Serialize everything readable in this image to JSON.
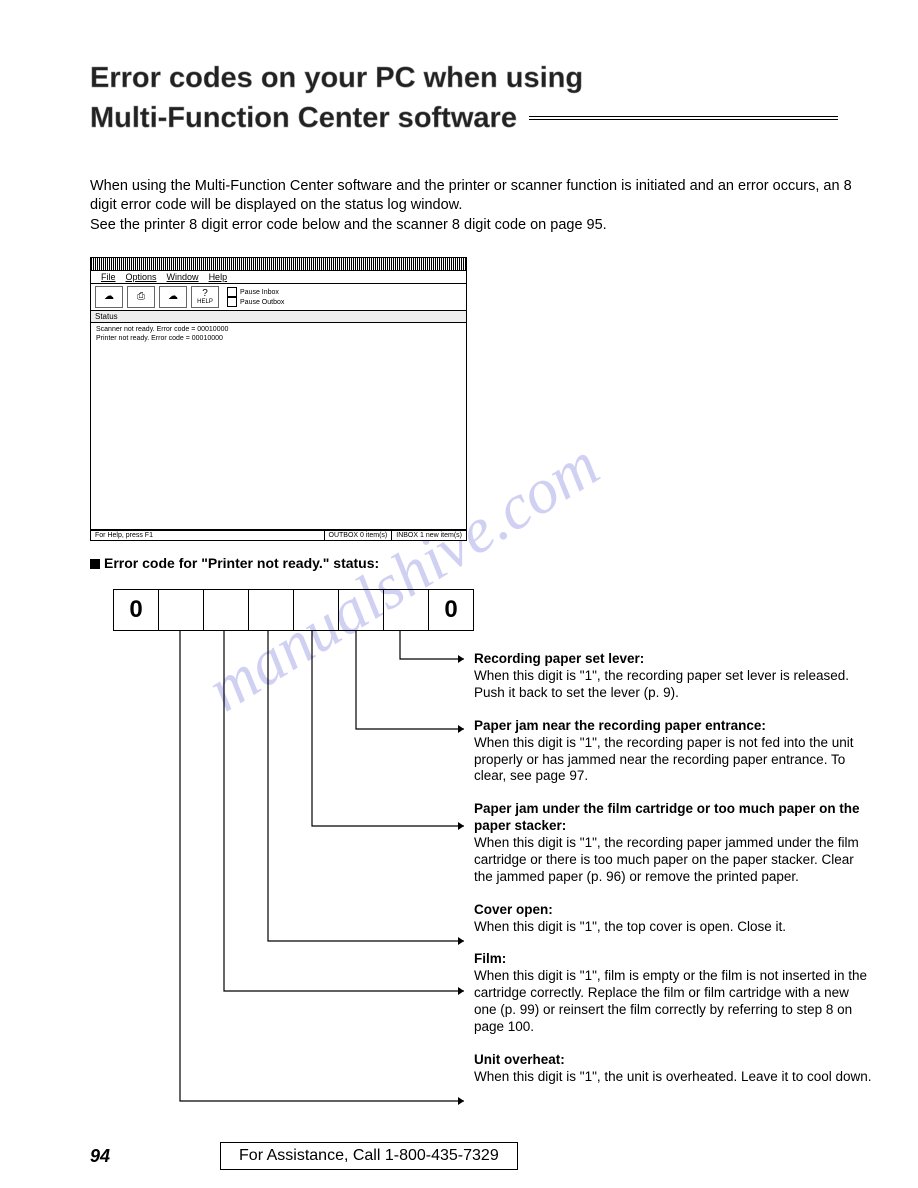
{
  "title_line1": "Error codes on your PC when using",
  "title_line2": "Multi-Function Center software",
  "intro_para": "When using the Multi-Function Center software and the printer or scanner function is initiated and an error occurs, an 8 digit error code will be displayed on the status log window.\nSee the printer 8 digit error code below and the scanner 8 digit code on page 95.",
  "window": {
    "menus": [
      "File",
      "Options",
      "Window",
      "Help"
    ],
    "toolbar_buttons": [
      {
        "label": ""
      },
      {
        "label": ""
      },
      {
        "label": ""
      },
      {
        "label": "HELP"
      }
    ],
    "checkboxes": [
      "Pause Inbox",
      "Pause Outbox"
    ],
    "status_header": "Status",
    "status_lines": [
      "Scanner not ready. Error code = 00010000",
      "Printer not ready. Error code = 00010000"
    ],
    "statusbar": [
      "For Help, press F1",
      "OUTBOX 0 item(s)",
      "INBOX 1 new item(s)"
    ]
  },
  "error_code_heading": "Error code for \"Printer not ready.\" status:",
  "digits": [
    "0",
    "",
    "",
    "",
    "",
    "",
    "",
    "0"
  ],
  "callouts": [
    {
      "title": "Recording paper set lever:",
      "text": "When this digit is \"1\", the recording paper set lever is released. Push it back to set the lever (p. 9)."
    },
    {
      "title": "Paper jam near the recording paper entrance:",
      "text": "When this digit is \"1\", the recording paper is not fed into the unit properly or has jammed near the recording paper entrance. To clear, see page 97."
    },
    {
      "title": "Paper jam under the film cartridge or too much paper on the paper stacker:",
      "text": "When this digit is \"1\", the recording paper jammed under the film cartridge or there is too much paper on the paper stacker. Clear the jammed paper (p. 96) or remove the printed paper."
    },
    {
      "title": "Cover open:",
      "text": "When this digit is \"1\", the top cover is open. Close it."
    },
    {
      "title": "Film:",
      "text": "When this digit is \"1\", film is empty or the film is not inserted in the cartridge correctly. Replace the film or film cartridge with a new one (p. 99) or reinsert the film correctly by referring to step 8 on page 100."
    },
    {
      "title": "Unit overheat:",
      "text": "When this digit is \"1\", the unit is overheated. Leave it to cool down."
    }
  ],
  "page_number": "94",
  "assistance": "For Assistance, Call 1-800-435-7329",
  "watermark": "manualshive.com"
}
